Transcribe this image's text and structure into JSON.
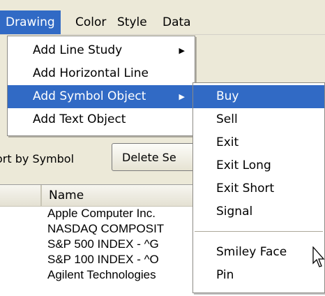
{
  "menubar": {
    "items": [
      {
        "label": "Drawing"
      },
      {
        "label": "Color"
      },
      {
        "label": "Style"
      },
      {
        "label": "Data"
      }
    ]
  },
  "drawing_menu": {
    "items": [
      {
        "label": "Add Line Study",
        "has_submenu": true
      },
      {
        "label": "Add Horizontal Line",
        "has_submenu": false
      },
      {
        "label": "Add Symbol Object",
        "has_submenu": true
      },
      {
        "label": "Add Text Object",
        "has_submenu": false
      }
    ]
  },
  "symbol_submenu": {
    "items": [
      {
        "label": "Buy"
      },
      {
        "label": "Sell"
      },
      {
        "label": "Exit"
      },
      {
        "label": "Exit Long"
      },
      {
        "label": "Exit Short"
      },
      {
        "label": "Signal"
      },
      {
        "label": "Smiley Face"
      },
      {
        "label": "Pin"
      }
    ]
  },
  "background": {
    "sort_label": "ort by Symbol",
    "delete_button_label": "Delete Se",
    "list_header_name": "Name",
    "rows": [
      "Apple Computer Inc.",
      "NASDAQ COMPOSIT",
      "S&P 500 INDEX - ^G",
      "S&P 100 INDEX - ^O",
      "Agilent Technologies"
    ]
  },
  "colors": {
    "highlight": "#316ac5",
    "face": "#ece9d8"
  }
}
